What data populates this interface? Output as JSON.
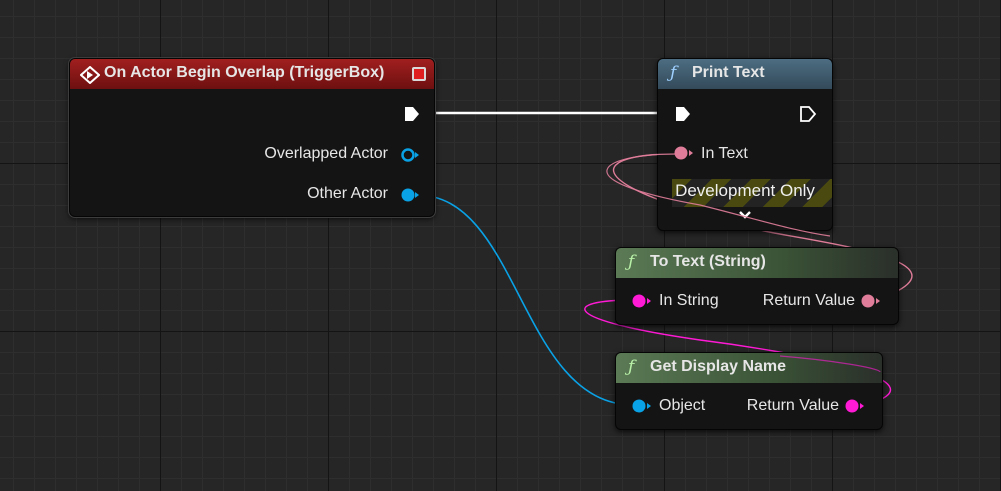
{
  "nodes": {
    "overlap": {
      "title": "On Actor Begin Overlap (TriggerBox)",
      "pins": {
        "overlapped_actor": "Overlapped Actor",
        "other_actor": "Other Actor"
      }
    },
    "print_text": {
      "title": "Print Text",
      "function_icon": "ƒ",
      "pins": {
        "in_text": "In Text"
      },
      "dev_only": "Development Only",
      "expand_icon": "chevron-down-icon"
    },
    "to_text": {
      "title": "To Text (String)",
      "function_icon": "ƒ",
      "pins": {
        "in_string": "In String",
        "return_value": "Return Value"
      }
    },
    "get_display_name": {
      "title": "Get Display Name",
      "function_icon": "ƒ",
      "pins": {
        "object": "Object",
        "return_value": "Return Value"
      }
    }
  },
  "colors": {
    "event_header": "#8f1c1c",
    "print_header": "#3f5a6c",
    "pure_header": "#4f6e4a",
    "exec_wire": "#ffffff",
    "object_pin": "#0aa2e6",
    "text_pin": "#e07d9a",
    "string_pin": "#ff1ad6"
  }
}
